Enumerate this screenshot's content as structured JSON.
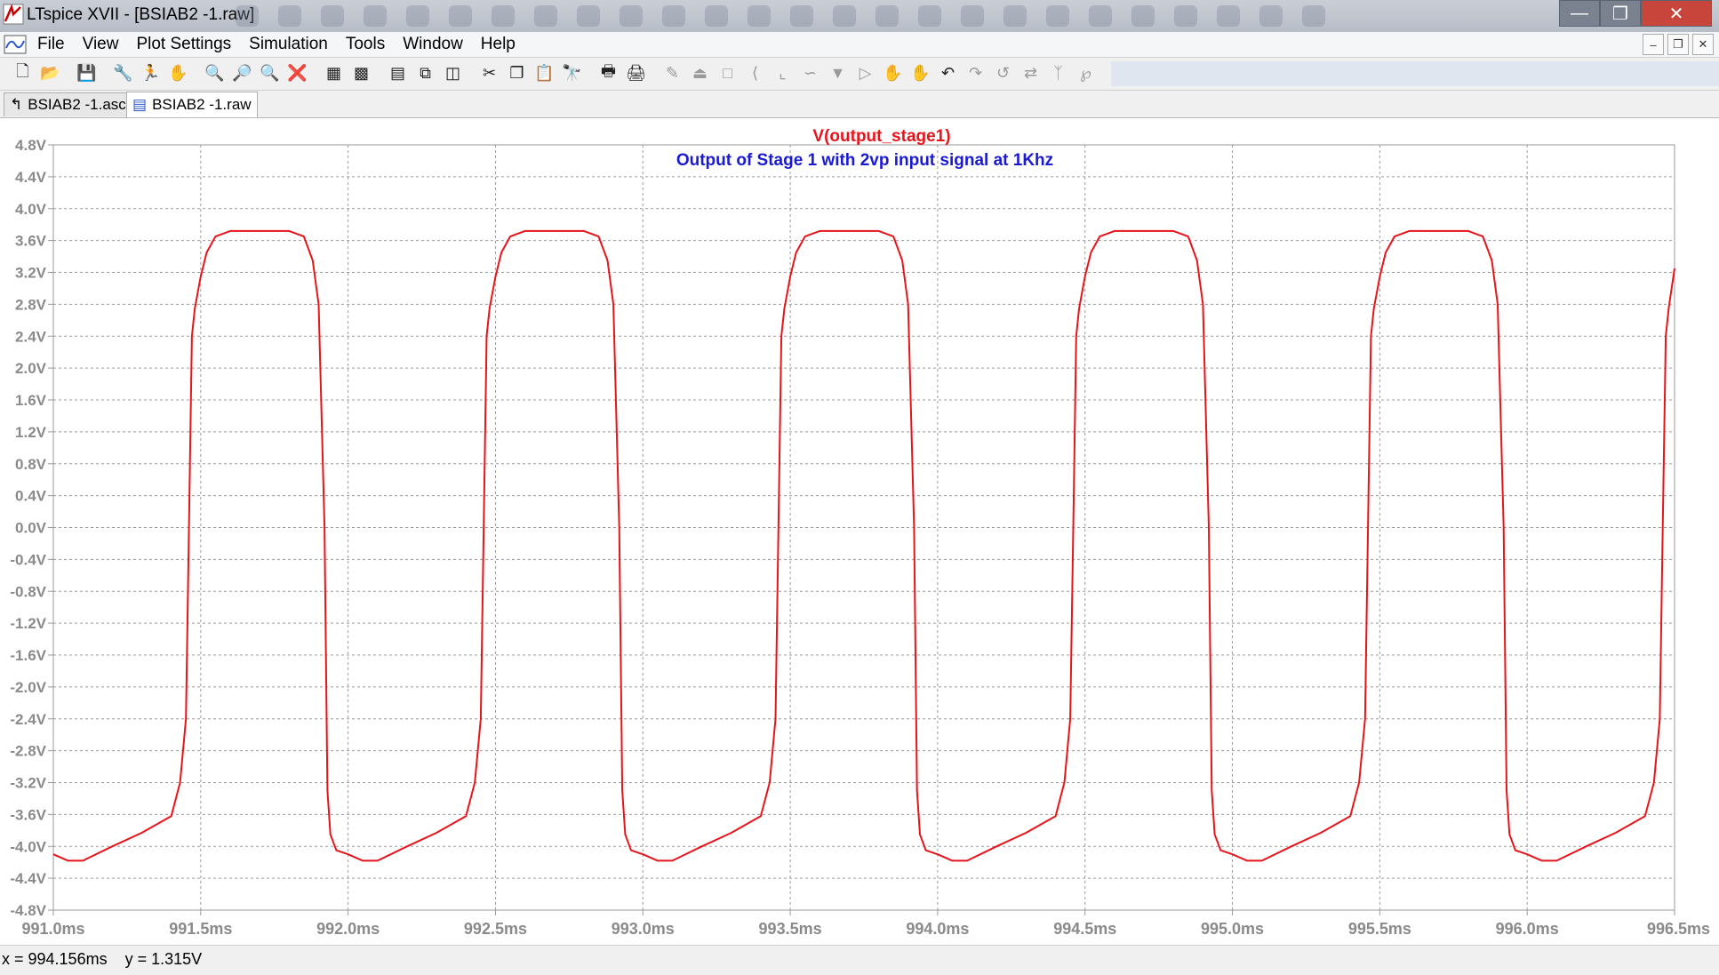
{
  "window": {
    "title": "LTspice XVII - [BSIAB2 -1.raw]",
    "controls": [
      "minimize",
      "restore",
      "close"
    ]
  },
  "menu": {
    "items": [
      "File",
      "View",
      "Plot Settings",
      "Simulation",
      "Tools",
      "Window",
      "Help"
    ]
  },
  "toolbar": {
    "icons": [
      "new-schematic-icon",
      "open-icon",
      "save-icon",
      "control-panel-icon",
      "run-icon",
      "halt-icon",
      "zoom-area-icon",
      "zoom-in-icon",
      "zoom-out-icon",
      "zoom-fit-icon",
      "autorange-icon",
      "grid-icon",
      "tile-horizontal-icon",
      "cascade-icon",
      "tile-vertical-icon",
      "cut-icon",
      "copy-icon",
      "paste-icon",
      "find-icon",
      "print-icon",
      "print-preview-icon",
      "wire-icon",
      "ground-icon",
      "label-icon",
      "resistor-icon",
      "capacitor-icon",
      "inductor-icon",
      "diode-icon",
      "component-icon",
      "drag-icon",
      "move-icon",
      "undo-icon",
      "redo-icon",
      "rotate-icon",
      "mirror-icon",
      "text-icon",
      "spice-directive-icon"
    ]
  },
  "tabs": [
    {
      "label": "BSIAB2 -1.asc",
      "active": false,
      "icon": "schematic-icon"
    },
    {
      "label": "BSIAB2 -1.raw",
      "active": true,
      "icon": "waveform-icon"
    }
  ],
  "status": {
    "cursor": "x = 994.156ms    y = 1.315V"
  },
  "chart_data": {
    "type": "line",
    "title": "V(output_stage1)",
    "subtitle": "Output of Stage 1 with 2vp input signal at 1Khz",
    "xlabel": "",
    "ylabel": "",
    "xlim": [
      991.0,
      996.5
    ],
    "ylim": [
      -4.8,
      4.8
    ],
    "x_ticks": [
      "991.0ms",
      "991.5ms",
      "992.0ms",
      "992.5ms",
      "993.0ms",
      "993.5ms",
      "994.0ms",
      "994.5ms",
      "995.0ms",
      "995.5ms",
      "996.0ms",
      "996.5ms"
    ],
    "y_ticks": [
      "4.8V",
      "4.4V",
      "4.0V",
      "3.6V",
      "3.2V",
      "2.8V",
      "2.4V",
      "2.0V",
      "1.6V",
      "1.2V",
      "0.8V",
      "0.4V",
      "0.0V",
      "-0.4V",
      "-0.8V",
      "-1.2V",
      "-1.6V",
      "-2.0V",
      "-2.4V",
      "-2.8V",
      "-3.2V",
      "-3.6V",
      "-4.0V",
      "-4.4V",
      "-4.8V"
    ],
    "grid": true,
    "series": [
      {
        "name": "V(output_stage1)",
        "color": "#e8141b",
        "x": [
          991.0,
          991.05,
          991.1,
          991.2,
          991.3,
          991.4,
          991.43,
          991.45,
          991.46,
          991.47,
          991.48,
          991.5,
          991.52,
          991.55,
          991.6,
          991.65,
          991.7,
          991.75,
          991.8,
          991.85,
          991.88,
          991.9,
          991.92,
          991.93,
          991.94,
          991.96,
          992.0,
          992.05,
          992.1,
          992.2,
          992.3,
          992.4,
          992.43,
          992.45,
          992.46,
          992.47,
          992.48,
          992.5,
          992.52,
          992.55,
          992.6,
          992.65,
          992.7,
          992.75,
          992.8,
          992.85,
          992.88,
          992.9,
          992.92,
          992.93,
          992.94,
          992.96,
          993.0,
          993.05,
          993.1,
          993.2,
          993.3,
          993.4,
          993.43,
          993.45,
          993.46,
          993.47,
          993.48,
          993.5,
          993.52,
          993.55,
          993.6,
          993.65,
          993.7,
          993.75,
          993.8,
          993.85,
          993.88,
          993.9,
          993.92,
          993.93,
          993.94,
          993.96,
          994.0,
          994.05,
          994.1,
          994.2,
          994.3,
          994.4,
          994.43,
          994.45,
          994.46,
          994.47,
          994.48,
          994.5,
          994.52,
          994.55,
          994.6,
          994.65,
          994.7,
          994.75,
          994.8,
          994.85,
          994.88,
          994.9,
          994.92,
          994.93,
          994.94,
          994.96,
          995.0,
          995.05,
          995.1,
          995.2,
          995.3,
          995.4,
          995.43,
          995.45,
          995.46,
          995.47,
          995.48,
          995.5,
          995.52,
          995.55,
          995.6,
          995.65,
          995.7,
          995.75,
          995.8,
          995.85,
          995.88,
          995.9,
          995.92,
          995.93,
          995.94,
          995.96,
          996.0,
          996.05,
          996.1,
          996.2,
          996.3,
          996.4,
          996.43,
          996.45,
          996.46,
          996.47,
          996.48,
          996.5
        ],
        "y": [
          -4.1,
          -4.18,
          -4.18,
          -4.0,
          -3.83,
          -3.62,
          -3.2,
          -2.4,
          0.0,
          2.4,
          2.75,
          3.15,
          3.45,
          3.65,
          3.72,
          3.72,
          3.72,
          3.72,
          3.72,
          3.65,
          3.35,
          2.8,
          0.0,
          -3.3,
          -3.85,
          -4.05,
          -4.1,
          -4.18,
          -4.18,
          -4.0,
          -3.83,
          -3.62,
          -3.2,
          -2.4,
          0.0,
          2.4,
          2.75,
          3.15,
          3.45,
          3.65,
          3.72,
          3.72,
          3.72,
          3.72,
          3.72,
          3.65,
          3.35,
          2.8,
          0.0,
          -3.3,
          -3.85,
          -4.05,
          -4.1,
          -4.18,
          -4.18,
          -4.0,
          -3.83,
          -3.62,
          -3.2,
          -2.4,
          0.0,
          2.4,
          2.75,
          3.15,
          3.45,
          3.65,
          3.72,
          3.72,
          3.72,
          3.72,
          3.72,
          3.65,
          3.35,
          2.8,
          0.0,
          -3.3,
          -3.85,
          -4.05,
          -4.1,
          -4.18,
          -4.18,
          -4.0,
          -3.83,
          -3.62,
          -3.2,
          -2.4,
          0.0,
          2.4,
          2.75,
          3.15,
          3.45,
          3.65,
          3.72,
          3.72,
          3.72,
          3.72,
          3.72,
          3.65,
          3.35,
          2.8,
          0.0,
          -3.3,
          -3.85,
          -4.05,
          -4.1,
          -4.18,
          -4.18,
          -4.0,
          -3.83,
          -3.62,
          -3.2,
          -2.4,
          0.0,
          2.4,
          2.75,
          3.15,
          3.45,
          3.65,
          3.72,
          3.72,
          3.72,
          3.72,
          3.72,
          3.65,
          3.35,
          2.8,
          0.0,
          -3.3,
          -3.85,
          -4.05,
          -4.1,
          -4.18,
          -4.18,
          -4.0,
          -3.83,
          -3.62,
          -3.2,
          -2.4,
          0.0,
          2.4,
          2.75,
          3.25
        ]
      }
    ]
  }
}
